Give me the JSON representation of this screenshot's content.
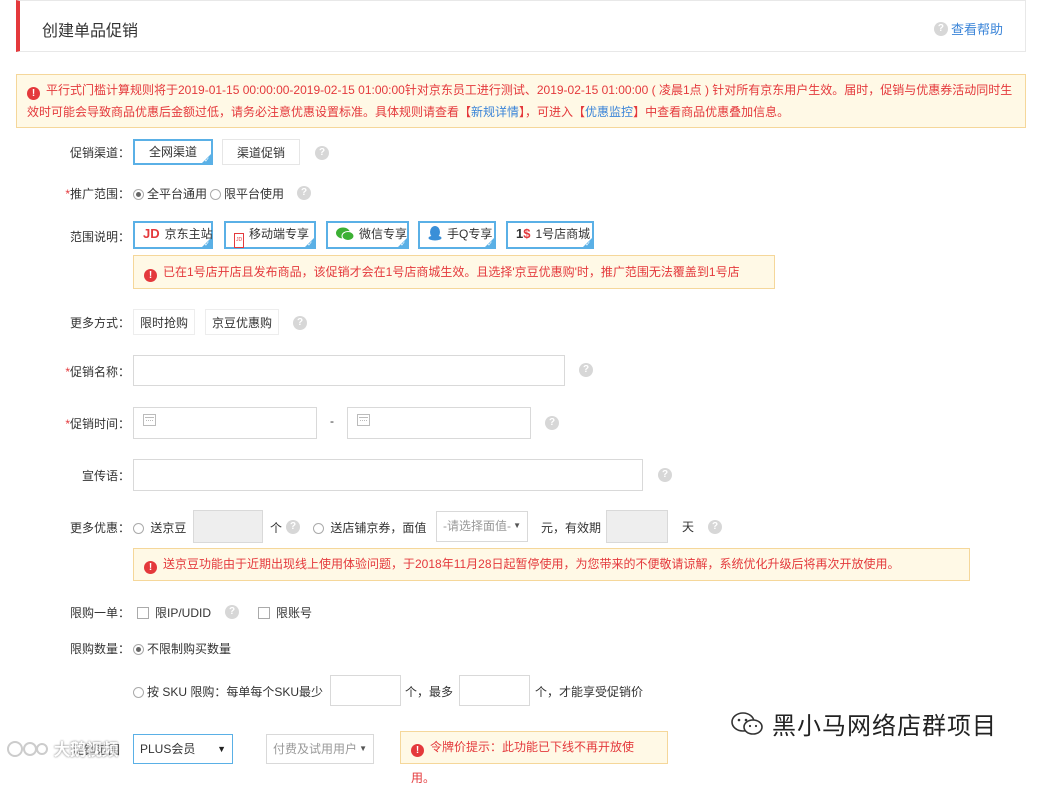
{
  "header": {
    "title": "创建单品促销",
    "help_label": "查看帮助"
  },
  "notice_main": {
    "text_1": "平行式门槛计算规则将于2019-01-15 00:00:00-2019-02-15 01:00:00针对京东员工进行测试、2019-02-15 01:00:00 ( 凌晨1点 ) 针对所有京东用户生效。届时，促销与优惠券活动同时生效时可能会导致商品优惠后金额过低，请务必注意优惠设置标准。具体规则请查看【",
    "link_1": "新规详情",
    "text_2": "】，可进入【",
    "link_2": "优惠监控",
    "text_3": "】中查看商品优惠叠加信息。"
  },
  "channel": {
    "label": "促销渠道：",
    "options": [
      "全网渠道",
      "渠道促销"
    ]
  },
  "scope": {
    "label": "推广范围：",
    "options": [
      "全平台通用",
      "限平台使用"
    ]
  },
  "range_desc": {
    "label": "范围说明：",
    "items": [
      "京东主站",
      "移动端专享",
      "微信专享",
      "手Q专享",
      "1号店商城"
    ],
    "notice": "已在1号店开店且发布商品，该促销才会在1号店商城生效。且选择'京豆优惠购'时，推广范围无法覆盖到1号店"
  },
  "more_methods": {
    "label": "更多方式：",
    "options": [
      "限时抢购",
      "京豆优惠购"
    ]
  },
  "promo_name": {
    "label": "促销名称："
  },
  "promo_time": {
    "label": "促销时间：",
    "separator": "-"
  },
  "slogan": {
    "label": "宣传语："
  },
  "more_offer": {
    "label": "更多优惠：",
    "send_beans": "送京豆",
    "unit_ge": "个",
    "send_coupon": "送店铺京券，面值",
    "select_placeholder": "-请选择面值-",
    "yuan_valid": "元，有效期",
    "unit_day": "天",
    "notice": "送京豆功能由于近期出现线上使用体验问题，于2018年11月28日起暂停使用，为您带来的不便敬请谅解，系统优化升级后将再次开放使用。"
  },
  "limit_one": {
    "label": "限购一单：",
    "options": [
      "限IP/UDID",
      "限账号"
    ]
  },
  "limit_qty": {
    "label": "限购数量：",
    "unlimited": "不限制购买数量",
    "by_sku": "按 SKU 限购：每单每个SKU最少",
    "unit_most": "个，最多",
    "unit_tail": "个，才能享受促销价"
  },
  "member_scope": {
    "label": "促销范围",
    "member_select": "PLUS会员",
    "user_select": "付费及试用用户",
    "notice": "令牌价提示：此功能已下线不再开放使用。"
  },
  "watermarks": {
    "right": "黑小马网络店群项目",
    "left": "大鹅视频"
  },
  "colors": {
    "accent_red": "#e4393c",
    "link_blue": "#3a84d8",
    "selected_border": "#5ab0e6"
  }
}
